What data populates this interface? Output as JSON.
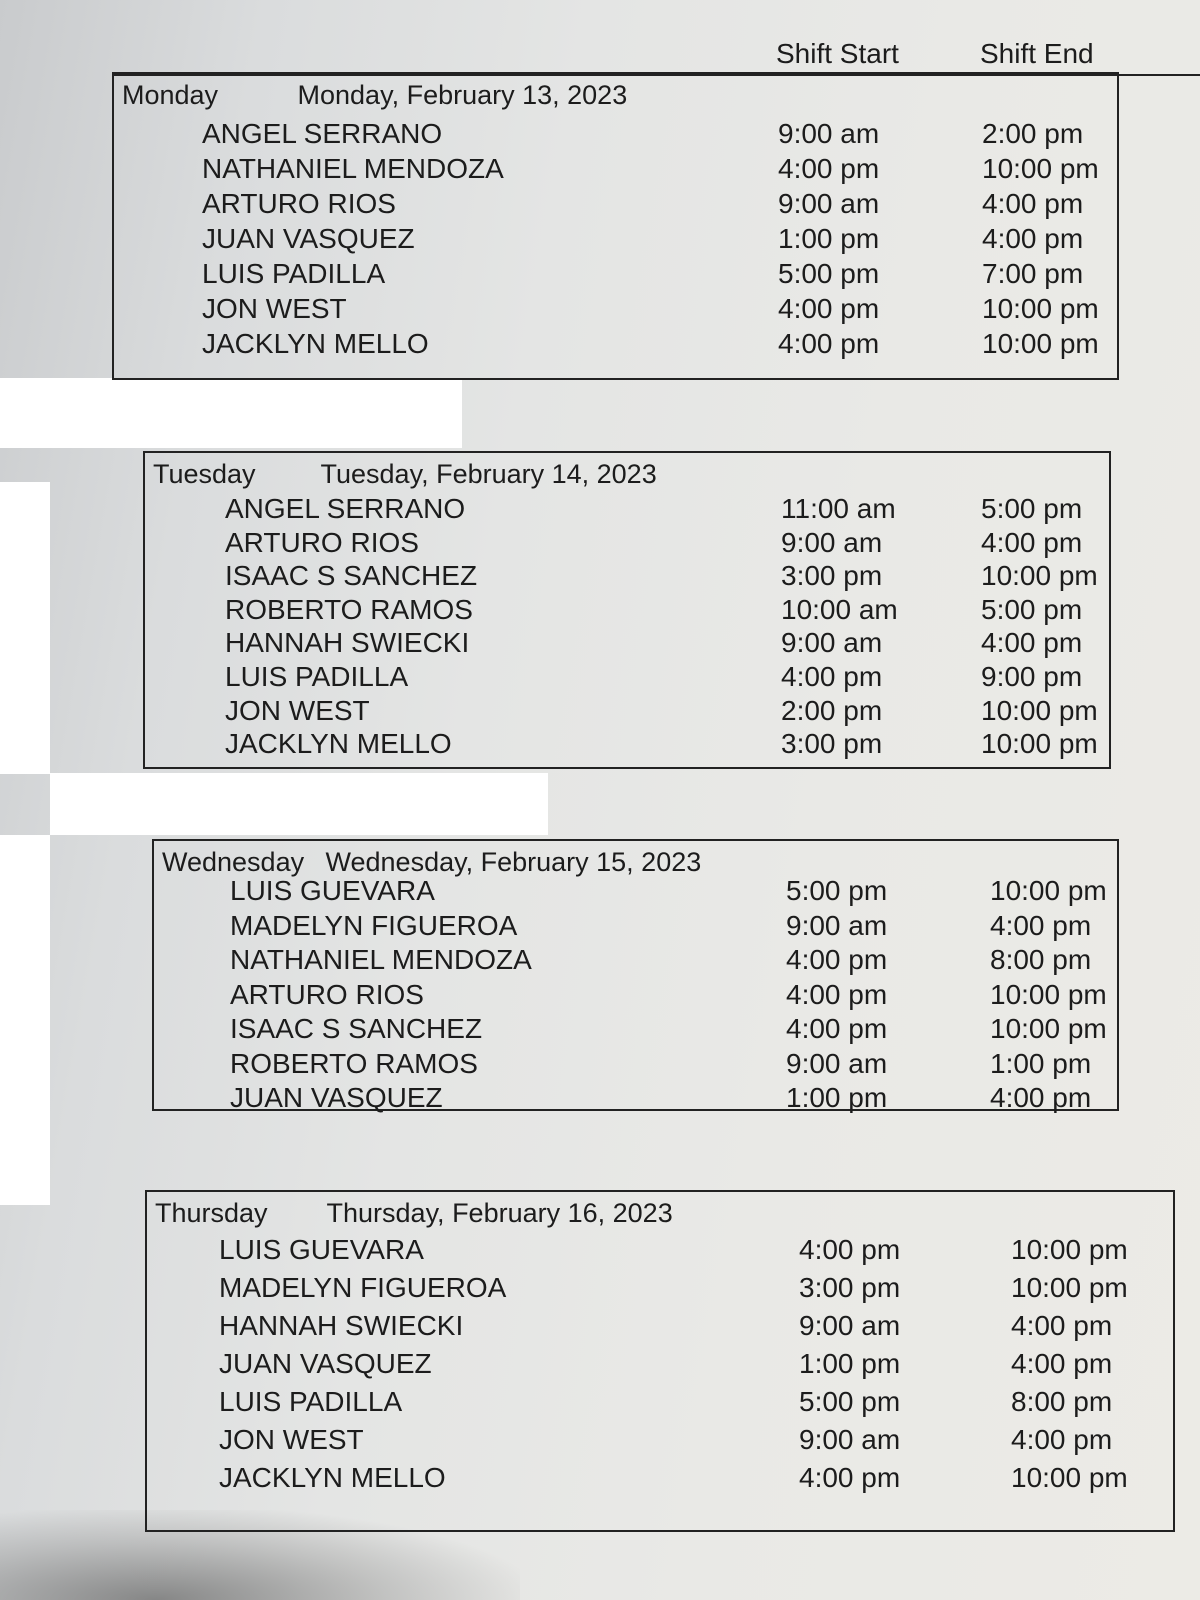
{
  "columns": {
    "shift_start": "Shift Start",
    "shift_end": "Shift End"
  },
  "days": [
    {
      "day": "Monday",
      "date": "Monday, February 13, 2023",
      "shifts": [
        {
          "name": "ANGEL SERRANO",
          "start": "9:00 am",
          "end": "2:00 pm"
        },
        {
          "name": "NATHANIEL MENDOZA",
          "start": "4:00 pm",
          "end": "10:00 pm"
        },
        {
          "name": "ARTURO RIOS",
          "start": "9:00 am",
          "end": "4:00 pm"
        },
        {
          "name": "JUAN VASQUEZ",
          "start": "1:00 pm",
          "end": "4:00 pm"
        },
        {
          "name": "LUIS PADILLA",
          "start": "5:00 pm",
          "end": "7:00 pm"
        },
        {
          "name": "JON WEST",
          "start": "4:00 pm",
          "end": "10:00 pm"
        },
        {
          "name": "JACKLYN MELLO",
          "start": "4:00 pm",
          "end": "10:00 pm"
        }
      ]
    },
    {
      "day": "Tuesday",
      "date": "Tuesday, February 14, 2023",
      "shifts": [
        {
          "name": "ANGEL SERRANO",
          "start": "11:00 am",
          "end": "5:00 pm"
        },
        {
          "name": "ARTURO RIOS",
          "start": "9:00 am",
          "end": "4:00 pm"
        },
        {
          "name": "ISAAC S SANCHEZ",
          "start": "3:00 pm",
          "end": "10:00 pm"
        },
        {
          "name": "ROBERTO RAMOS",
          "start": "10:00 am",
          "end": "5:00 pm"
        },
        {
          "name": "HANNAH SWIECKI",
          "start": "9:00 am",
          "end": "4:00 pm"
        },
        {
          "name": "LUIS PADILLA",
          "start": "4:00 pm",
          "end": "9:00 pm"
        },
        {
          "name": "JON WEST",
          "start": "2:00 pm",
          "end": "10:00 pm"
        },
        {
          "name": "JACKLYN MELLO",
          "start": "3:00 pm",
          "end": "10:00 pm"
        }
      ]
    },
    {
      "day": "Wednesday",
      "date": "Wednesday, February 15, 2023",
      "shifts": [
        {
          "name": "LUIS GUEVARA",
          "start": "5:00 pm",
          "end": "10:00 pm"
        },
        {
          "name": "MADELYN FIGUEROA",
          "start": "9:00 am",
          "end": "4:00 pm"
        },
        {
          "name": "NATHANIEL MENDOZA",
          "start": "4:00 pm",
          "end": "8:00 pm"
        },
        {
          "name": "ARTURO RIOS",
          "start": "4:00 pm",
          "end": "10:00 pm"
        },
        {
          "name": "ISAAC S SANCHEZ",
          "start": "4:00 pm",
          "end": "10:00 pm"
        },
        {
          "name": "ROBERTO RAMOS",
          "start": "9:00 am",
          "end": "1:00 pm"
        },
        {
          "name": "JUAN VASQUEZ",
          "start": "1:00 pm",
          "end": "4:00 pm"
        }
      ]
    },
    {
      "day": "Thursday",
      "date": "Thursday, February 16, 2023",
      "shifts": [
        {
          "name": "LUIS GUEVARA",
          "start": "4:00 pm",
          "end": "10:00 pm"
        },
        {
          "name": "MADELYN FIGUEROA",
          "start": "3:00 pm",
          "end": "10:00 pm"
        },
        {
          "name": "HANNAH SWIECKI",
          "start": "9:00 am",
          "end": "4:00 pm"
        },
        {
          "name": "JUAN VASQUEZ",
          "start": "1:00 pm",
          "end": "4:00 pm"
        },
        {
          "name": "LUIS PADILLA",
          "start": "5:00 pm",
          "end": "8:00 pm"
        },
        {
          "name": "JON WEST",
          "start": "9:00 am",
          "end": "4:00 pm"
        },
        {
          "name": "JACKLYN MELLO",
          "start": "4:00 pm",
          "end": "10:00 pm"
        }
      ]
    }
  ]
}
